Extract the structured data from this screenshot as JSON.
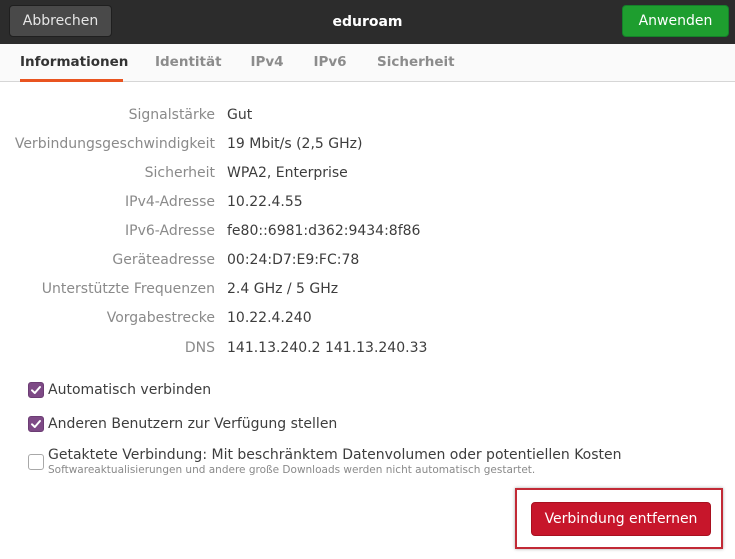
{
  "header": {
    "title": "eduroam",
    "cancel_label": "Abbrechen",
    "apply_label": "Anwenden"
  },
  "tabs": [
    {
      "label": "Informationen",
      "active": true
    },
    {
      "label": "Identität",
      "active": false
    },
    {
      "label": "IPv4",
      "active": false
    },
    {
      "label": "IPv6",
      "active": false
    },
    {
      "label": "Sicherheit",
      "active": false
    }
  ],
  "details": [
    {
      "label": "Signalstärke",
      "value": "Gut"
    },
    {
      "label": "Verbindungsgeschwindigkeit",
      "value": "19 Mbit/s (2,5 GHz)"
    },
    {
      "label": "Sicherheit",
      "value": "WPA2, Enterprise"
    },
    {
      "label": "IPv4-Adresse",
      "value": "10.22.4.55"
    },
    {
      "label": "IPv6-Adresse",
      "value": "fe80::6981:d362:9434:8f86"
    },
    {
      "label": "Geräteadresse",
      "value": "00:24:D7:E9:FC:78"
    },
    {
      "label": "Unterstützte Frequenzen",
      "value": "2.4 GHz / 5 GHz"
    },
    {
      "label": "Vorgabestrecke",
      "value": "10.22.4.240"
    },
    {
      "label": "DNS",
      "value": "141.13.240.2 141.13.240.33"
    }
  ],
  "options": {
    "auto_connect": {
      "label": "Automatisch verbinden",
      "checked": true
    },
    "share_users": {
      "label": "Anderen Benutzern zur Verfügung stellen",
      "checked": true
    },
    "metered": {
      "label": "Getaktete Verbindung: Mit beschränktem Datenvolumen oder potentiellen Kosten",
      "sublabel": "Softwareaktualisierungen und andere große Downloads werden nicht automatisch gestartet.",
      "checked": false
    }
  },
  "footer": {
    "remove_label": "Verbindung entfernen"
  },
  "colors": {
    "accent_tab": "#e95420",
    "checkbox": "#7e4a86",
    "apply": "#1e9e2f",
    "destructive": "#c7162b",
    "highlight": "#c22a36"
  }
}
